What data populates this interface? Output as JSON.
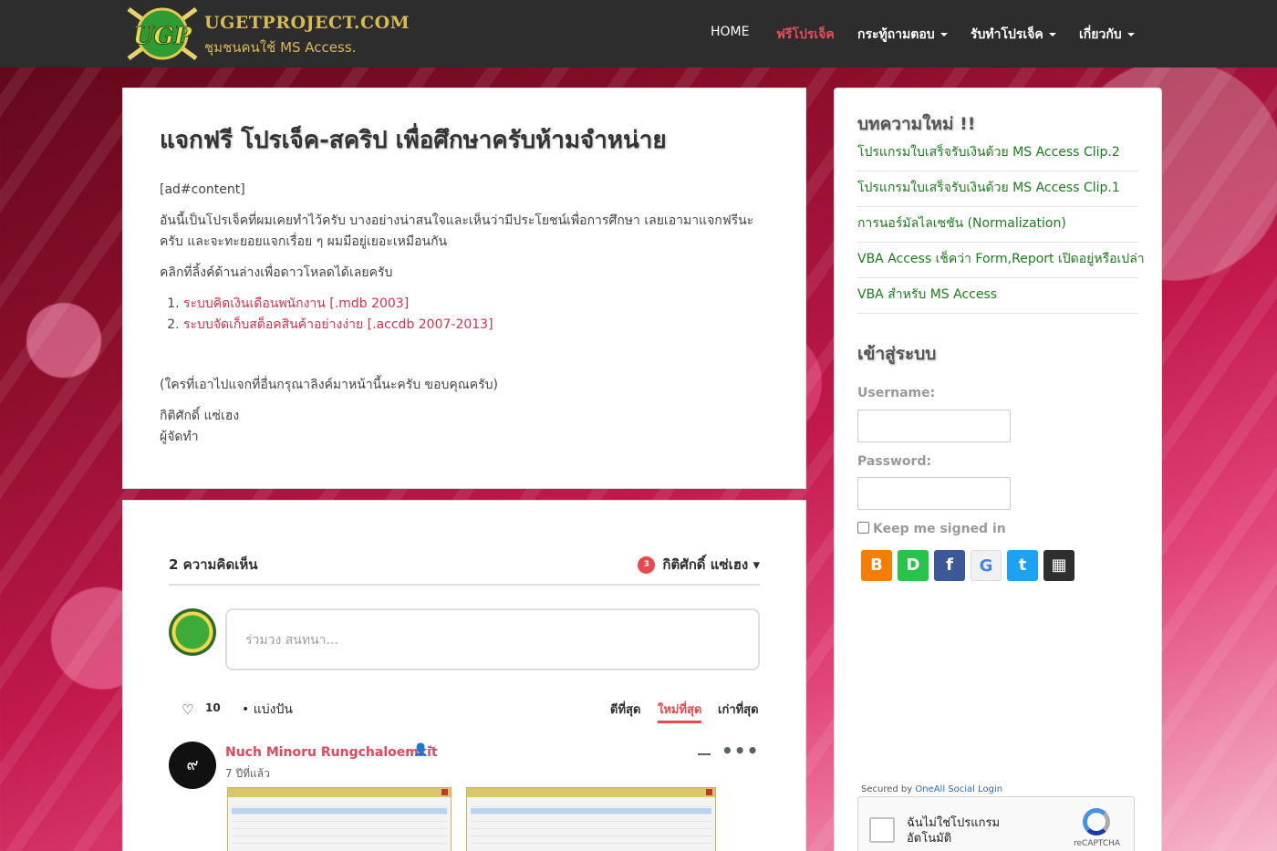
{
  "site": {
    "logo_letters": "UGP",
    "title": "UGETPROJECT.COM",
    "subtitle": "ชุมชนคนใช้ MS Access."
  },
  "nav": {
    "items": [
      {
        "label": "HOME"
      },
      {
        "label": "ฟรีโปรเจ็ค"
      },
      {
        "label": "กระทู้ถามตอบ"
      },
      {
        "label": "รับทำโปรเจ็ค"
      },
      {
        "label": "เกี่ยวกับ"
      }
    ]
  },
  "post": {
    "title": "แจกฟรี โปรเจ็ค-สคริป เพื่อศึกษาครับห้ามจำหน่าย",
    "ad_tag": "[ad#content]",
    "intro": "อันนี้เป็นโปรเจ็คที่ผมเคยทำไว้ครับ บางอย่างน่าสนใจและเห็นว่ามีประโยชน์เพื่อการศึกษา เลยเอามาแจกฟรีนะครับ และจะทะยอยแจกเรื่อย ๆ ผมมีอยู่เยอะเหมือนกัน",
    "instruction": "คลิกที่ลิ้งค์ด้านล่างเพื่อดาวโหลดได้เลยครับ",
    "links": [
      {
        "label": "ระบบคิดเงินเดือนพนักงาน [.mdb 2003]"
      },
      {
        "label": "ระบบจัดเก็บสต็อคสินค้าอย่างง่าย [.accdb 2007-2013]"
      }
    ],
    "note": "(ใครที่เอาไปแจกที่อื่นกรุณาลิงค์มาหน้านี้นะครับ ขอบคุณครับ)",
    "author": "กิติศักดิ์ แซ่เฮง",
    "author_role": "ผู้จัดทำ"
  },
  "comments": {
    "count_label": "2 ความคิดเห็น",
    "notify_count": "3",
    "user": "กิติศักดิ์ แซ่เฮง",
    "input_placeholder": "ร่วมวง สนทนา...",
    "likes": "10",
    "share_label": "แบ่งปัน",
    "sort": [
      {
        "label": "ดีที่สุด"
      },
      {
        "label": "ใหม่ที่สุด"
      },
      {
        "label": "เก่าที่สุด"
      }
    ],
    "first": {
      "avatar_text": "๙",
      "author": "Nuch Minoru Rungchaloemkit",
      "time": "7 ปีที่แล้ว"
    }
  },
  "sidebar": {
    "new_articles_heading": "บทความใหม่ !!",
    "articles": [
      {
        "label": "โปรแกรมใบเสร็จรับเงินด้วย MS Access Clip.2"
      },
      {
        "label": "โปรแกรมใบเสร็จรับเงินด้วย MS Access Clip.1"
      },
      {
        "label": "การนอร์มัลไลเซชัน (Normalization)"
      },
      {
        "label": "VBA Access เช็คว่า Form,Report เปิดอยู่หรือเปล่า"
      },
      {
        "label": "VBA สำหรับ MS Access"
      }
    ],
    "login_heading": "เข้าสู่ระบบ",
    "username_label": "Username:",
    "password_label": "Password:",
    "keep_signed_in": "Keep me signed in",
    "secured_prefix": "Secured by",
    "secured_link": "OneAll Social Login",
    "recaptcha_text": "ฉันไม่ใช่โปรแกรม อัตโนมัติ",
    "recaptcha_brand": "reCAPTCHA",
    "social_icons": [
      "blogger-icon",
      "disqus-icon",
      "facebook-icon",
      "google-icon",
      "twitter-icon",
      "windows-icon"
    ],
    "social_glyphs": [
      "B",
      "D",
      "f",
      "G",
      "t",
      "▦"
    ]
  },
  "colors": {
    "nav_bg": "#2d2d2d",
    "nav_active": "#e74c5b",
    "link_red": "#d9304a",
    "sidebar_link": "#1a7d1a",
    "disqus_red": "#e9484d"
  }
}
